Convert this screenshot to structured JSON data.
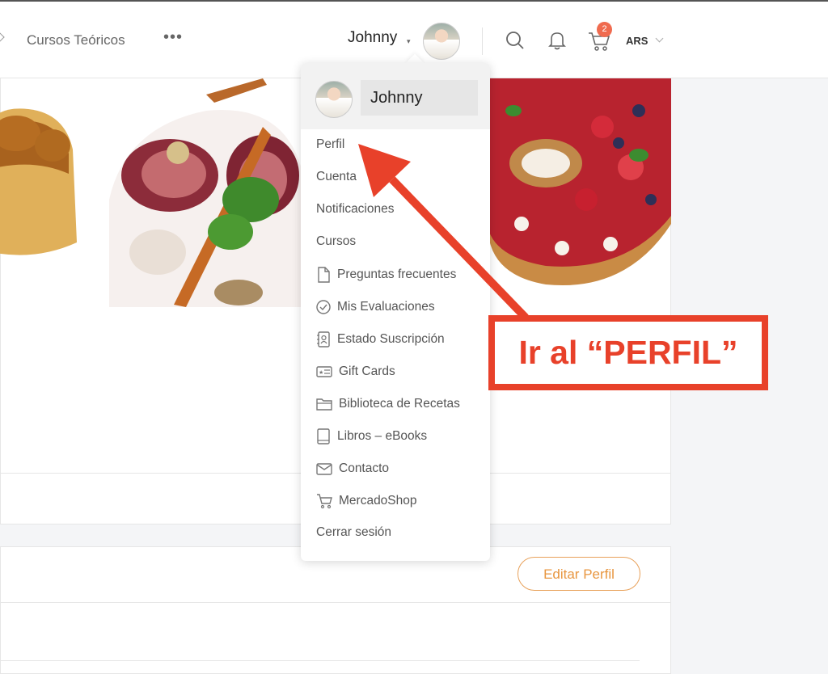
{
  "topbar": {
    "nav_link": "Cursos Teóricos",
    "more": "•••",
    "user_name": "Johnny",
    "cart_count": "2",
    "currency": "ARS"
  },
  "dropdown": {
    "user_name": "Johnny",
    "items": [
      {
        "label": "Perfil",
        "icon": null
      },
      {
        "label": "Cuenta",
        "icon": null
      },
      {
        "label": "Notificaciones",
        "icon": null
      },
      {
        "label": "Cursos",
        "icon": null
      },
      {
        "label": "Preguntas frecuentes",
        "icon": "document-icon"
      },
      {
        "label": "Mis Evaluaciones",
        "icon": "check-circle-icon"
      },
      {
        "label": "Estado Suscripción",
        "icon": "contact-book-icon"
      },
      {
        "label": "Gift Cards",
        "icon": "gift-card-icon"
      },
      {
        "label": "Biblioteca de Recetas",
        "icon": "folder-icon"
      },
      {
        "label": "Libros – eBooks",
        "icon": "book-icon"
      },
      {
        "label": "Contacto",
        "icon": "mail-icon"
      },
      {
        "label": "MercadoShop",
        "icon": "cart-icon"
      },
      {
        "label": "Cerrar sesión",
        "icon": null
      }
    ]
  },
  "profile": {
    "edit_button": "Editar Perfil"
  },
  "annotation": {
    "text": "Ir al “PERFIL”"
  },
  "colors": {
    "accent_orange": "#e8963f",
    "badge": "#f06b4f",
    "annotation_red": "#e8412a"
  }
}
